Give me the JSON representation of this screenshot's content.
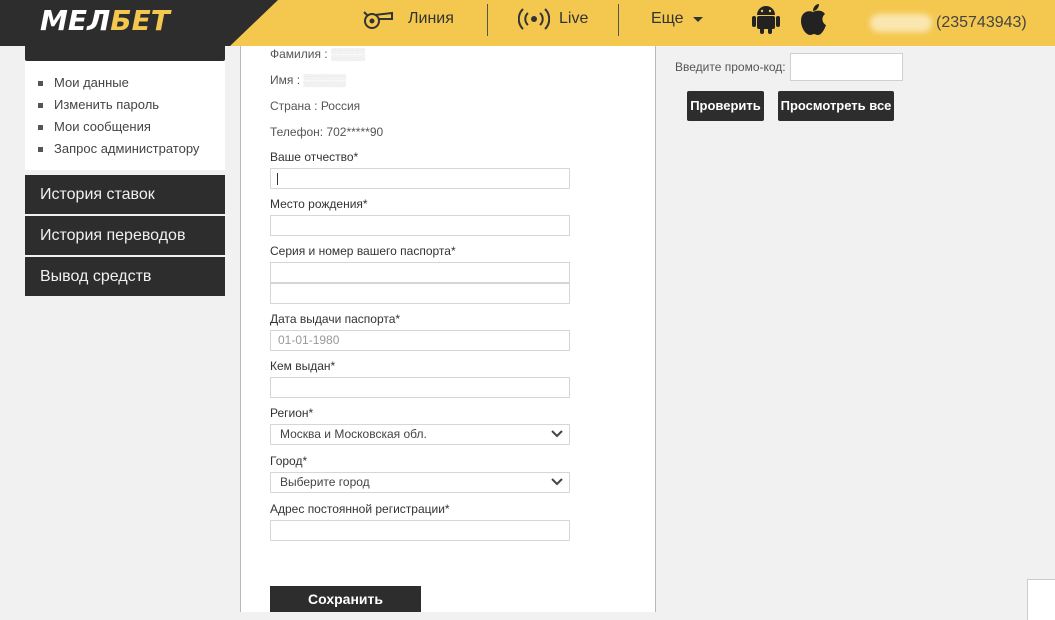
{
  "header": {
    "logo_white": "МЕЛ",
    "logo_yellow": "БЕТ",
    "nav": {
      "line": "Линия",
      "live": "Live",
      "more": "Еще"
    },
    "user_id": "(235743943)"
  },
  "sidebar": {
    "links": [
      "Мои данные",
      "Изменить пароль",
      "Мои сообщения",
      "Запрос администратору"
    ],
    "buttons": [
      "История ставок",
      "История переводов",
      "Вывод средств"
    ]
  },
  "form": {
    "surname_label": "Фамилия :",
    "name_label": "Имя :",
    "country": "Страна : Россия",
    "phone": "Телефон: 702*****90",
    "patronymic_label": "Ваше отчество*",
    "birthplace_label": "Место рождения*",
    "passport_label": "Серия и номер вашего паспорта*",
    "issue_date_label": "Дата выдачи паспорта*",
    "issue_date_placeholder": "01-01-1980",
    "issued_by_label": "Кем выдан*",
    "region_label": "Регион*",
    "region_value": "Москва и Московская обл.",
    "city_label": "Город*",
    "city_value": "Выберите город",
    "address_label": "Адрес постоянной регистрации*",
    "save_label": "Сохранить"
  },
  "promo": {
    "label": "Введите промо-код:",
    "check_label": "Проверить",
    "view_all_label": "Просмотреть все"
  }
}
